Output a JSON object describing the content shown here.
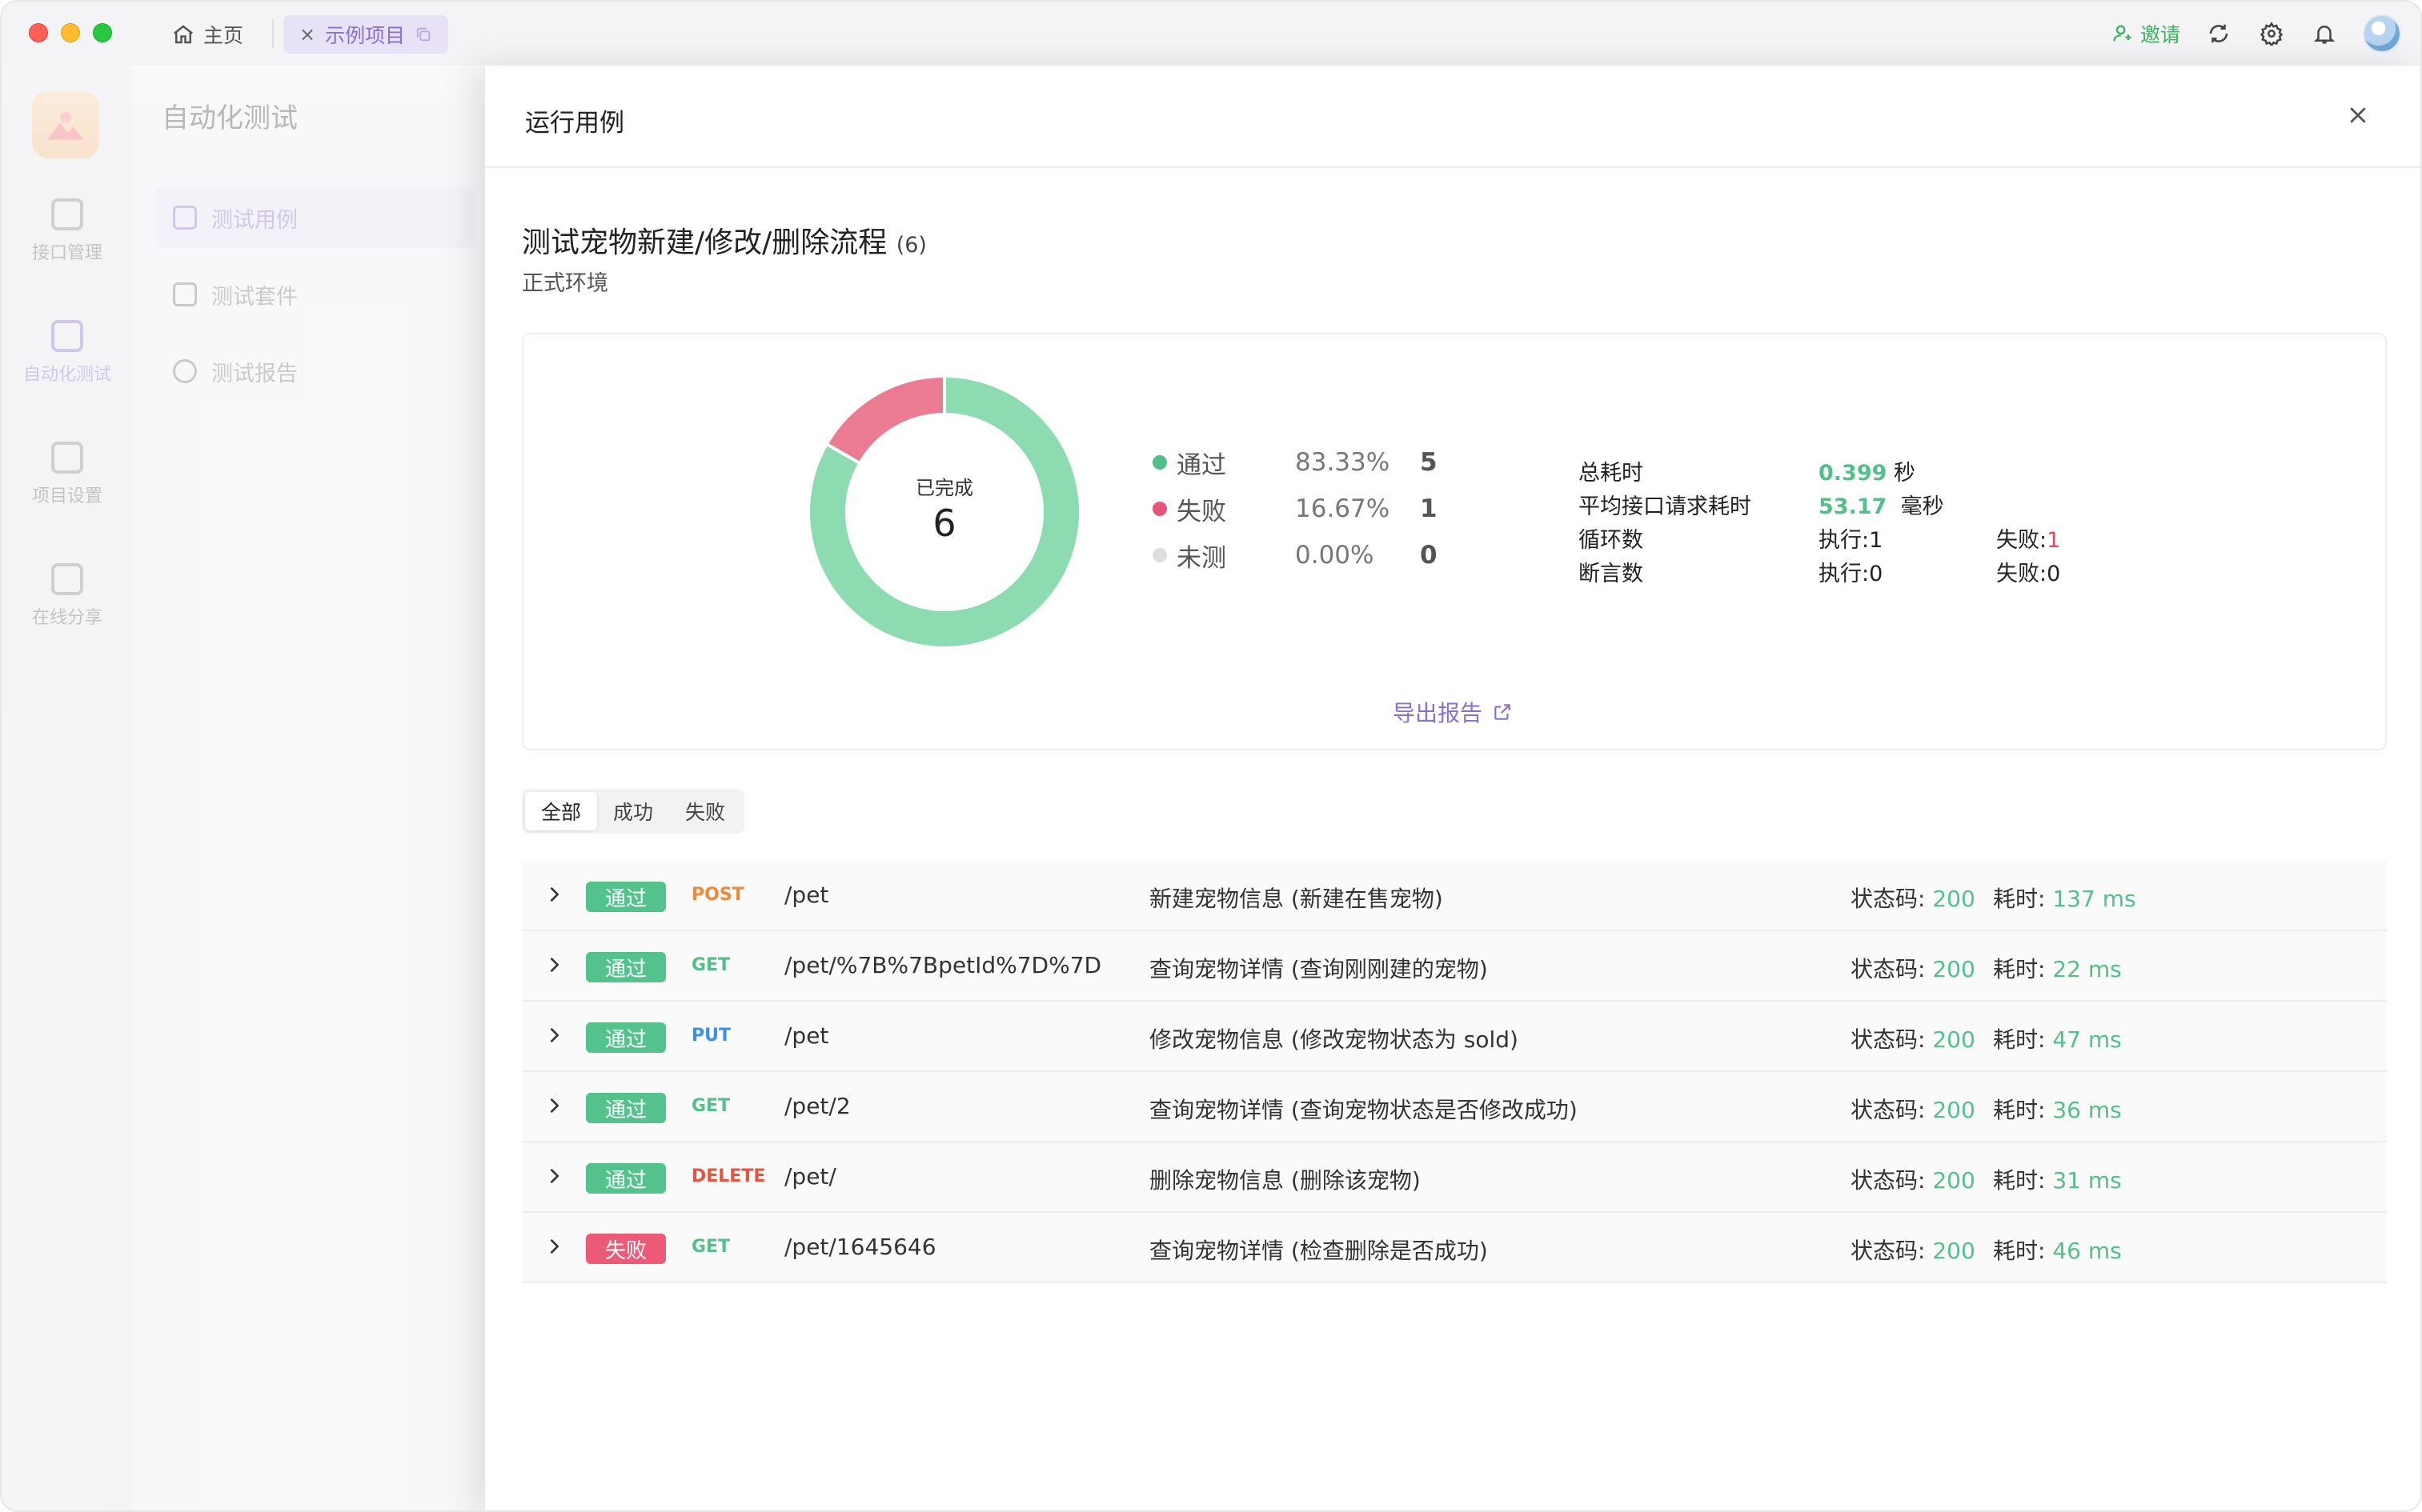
{
  "titlebar": {
    "home_tab": "主页",
    "project_tab": "示例项目",
    "invite": "邀请"
  },
  "nav": {
    "items": [
      {
        "label": "接口管理"
      },
      {
        "label": "自动化测试"
      },
      {
        "label": "项目设置"
      },
      {
        "label": "在线分享"
      }
    ]
  },
  "sidebar": {
    "title": "自动化测试",
    "items": [
      {
        "label": "测试用例"
      },
      {
        "label": "测试套件"
      },
      {
        "label": "测试报告"
      }
    ]
  },
  "drawer": {
    "title": "运行用例",
    "case_title": "测试宠物新建/修改/删除流程",
    "case_count": "(6)",
    "environment": "正式环境",
    "donut": {
      "label": "已完成",
      "total": "6",
      "pass_fraction": 0.8333,
      "fail_fraction": 0.1667,
      "untested_fraction": 0.0,
      "pass_color": "#8ddbb1",
      "fail_color": "#ea7b92"
    },
    "legend": [
      {
        "name": "通过",
        "percent": "83.33%",
        "count": "5",
        "color": "#53c08a"
      },
      {
        "name": "失败",
        "percent": "16.67%",
        "count": "1",
        "color": "#e5557a"
      },
      {
        "name": "未测",
        "percent": "0.00%",
        "count": "0",
        "color": "#dddddd"
      }
    ],
    "stats": {
      "total_time_label": "总耗时",
      "total_time_value": "0.399",
      "total_time_unit": "秒",
      "avg_label": "平均接口请求耗时",
      "avg_value": "53.17",
      "avg_unit": "毫秒",
      "loop_label": "循环数",
      "loop_exec": "执行:1",
      "loop_fail_label": "失败:",
      "loop_fail_value": "1",
      "assert_label": "断言数",
      "assert_exec": "执行:0",
      "assert_fail": "失败:0"
    },
    "export_label": "导出报告",
    "filters": [
      "全部",
      "成功",
      "失败"
    ],
    "rows": [
      {
        "status": "通过",
        "method": "POST",
        "method_color": "#ee8a3a",
        "path": "/pet",
        "desc": "新建宠物信息 (新建在售宠物)",
        "code_label": "状态码: ",
        "code": "200",
        "time_label": "耗时: ",
        "time": "137 ms"
      },
      {
        "status": "通过",
        "method": "GET",
        "method_color": "#53c08a",
        "path": "/pet/%7B%7BpetId%7D%7D",
        "desc": "查询宠物详情 (查询刚刚建的宠物)",
        "code_label": "状态码: ",
        "code": "200",
        "time_label": "耗时: ",
        "time": "22 ms"
      },
      {
        "status": "通过",
        "method": "PUT",
        "method_color": "#3f8fe8",
        "path": "/pet",
        "desc": "修改宠物信息 (修改宠物状态为 sold)",
        "code_label": "状态码: ",
        "code": "200",
        "time_label": "耗时: ",
        "time": "47 ms"
      },
      {
        "status": "通过",
        "method": "GET",
        "method_color": "#53c08a",
        "path": "/pet/2",
        "desc": "查询宠物详情 (查询宠物状态是否修改成功)",
        "code_label": "状态码: ",
        "code": "200",
        "time_label": "耗时: ",
        "time": "36 ms"
      },
      {
        "status": "通过",
        "method": "DELETE",
        "method_color": "#e8533f",
        "path": "/pet/",
        "desc": "删除宠物信息 (删除该宠物)",
        "code_label": "状态码: ",
        "code": "200",
        "time_label": "耗时: ",
        "time": "31 ms"
      },
      {
        "status": "失败",
        "method": "GET",
        "method_color": "#53c08a",
        "path": "/pet/1645646",
        "desc": "查询宠物详情 (检查删除是否成功)",
        "code_label": "状态码: ",
        "code": "200",
        "time_label": "耗时: ",
        "time": "46 ms"
      }
    ]
  }
}
